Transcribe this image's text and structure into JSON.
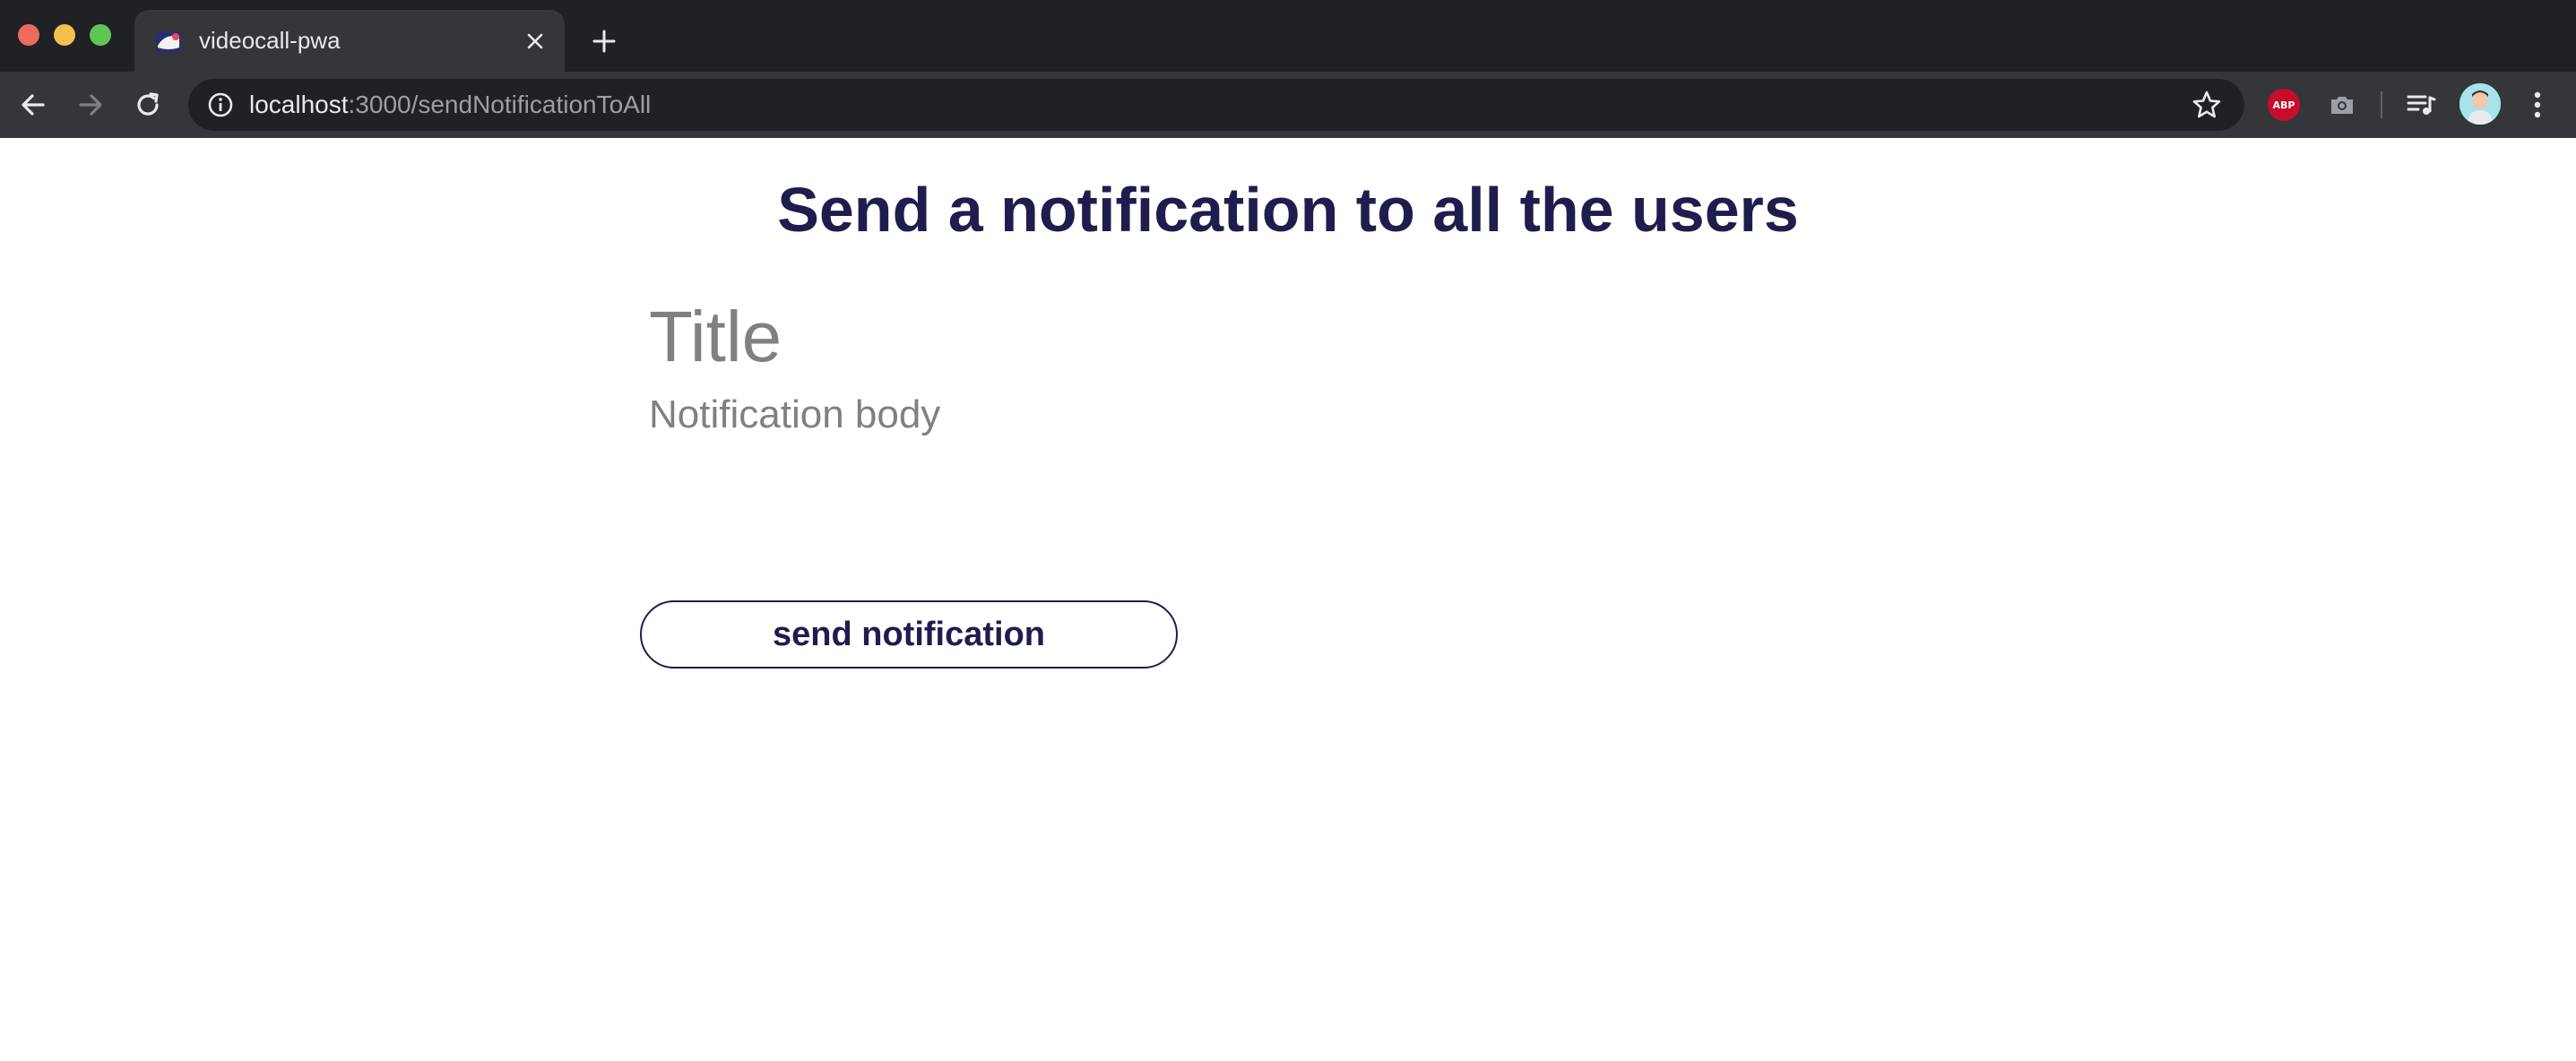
{
  "browser": {
    "tab_title": "videocall-pwa",
    "url_host": "localhost",
    "url_path": ":3000/sendNotificationToAll",
    "extensions": {
      "abp_label": "ABP"
    }
  },
  "page": {
    "heading": "Send a notification to all the users",
    "title_field": {
      "placeholder": "Title",
      "value": ""
    },
    "body_field": {
      "placeholder": "Notification body",
      "value": ""
    },
    "send_button_label": "send notification"
  },
  "colors": {
    "accent": "#1f1d4e",
    "placeholder": "#808080",
    "chrome_dark": "#202124",
    "chrome_toolbar": "#35363a"
  },
  "icons": [
    "back-arrow-icon",
    "forward-arrow-icon",
    "reload-icon",
    "info-icon",
    "star-icon",
    "abp-icon",
    "camera-icon",
    "media-queue-icon",
    "menu-dots-icon",
    "close-icon",
    "plus-icon"
  ]
}
